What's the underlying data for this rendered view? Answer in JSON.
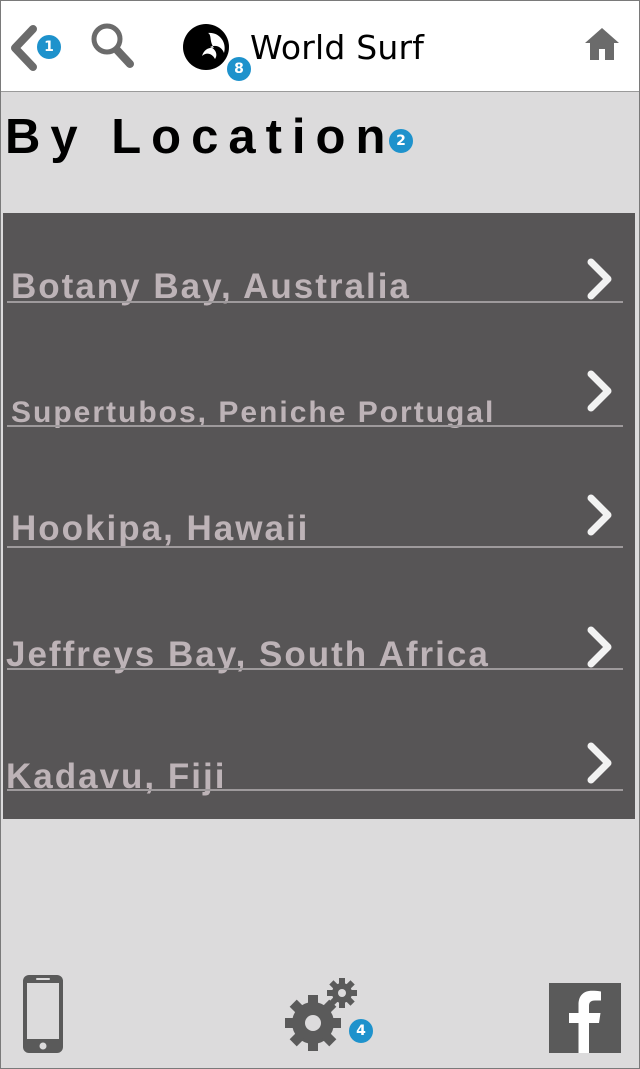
{
  "header": {
    "title": "World Surf",
    "back_badge": "1",
    "logo_badge": "8"
  },
  "page": {
    "title": "By Location",
    "title_badge": "2"
  },
  "locations": [
    {
      "label": "Botany Bay, Australia"
    },
    {
      "label": "Supertubos, Peniche Portugal"
    },
    {
      "label": "Hookipa, Hawaii"
    },
    {
      "label": "Jeffreys Bay, South Africa"
    },
    {
      "label": "Kadavu, Fiji"
    }
  ],
  "footer": {
    "settings_badge": "4"
  },
  "colors": {
    "background": "#dcdbdc",
    "panel": "#575556",
    "item_text": "#bdb3b7",
    "badge": "#1e92cc",
    "icon_gray": "#5a5a5a"
  },
  "icons": [
    "back-icon",
    "search-icon",
    "logo-icon",
    "home-icon",
    "chevron-right-icon",
    "phone-icon",
    "settings-icon",
    "facebook-icon"
  ]
}
